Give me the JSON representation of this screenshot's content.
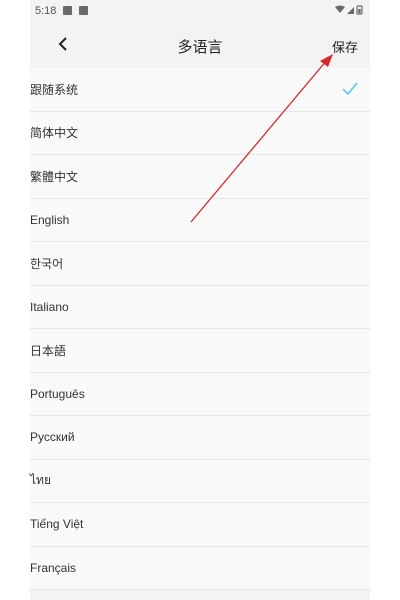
{
  "status_bar": {
    "time": "5:18"
  },
  "header": {
    "title": "多语言",
    "save_label": "保存"
  },
  "languages": [
    {
      "label": "跟随系统",
      "selected": true
    },
    {
      "label": "简体中文",
      "selected": false
    },
    {
      "label": "繁體中文",
      "selected": false
    },
    {
      "label": "English",
      "selected": false
    },
    {
      "label": "한국어",
      "selected": false
    },
    {
      "label": "Italiano",
      "selected": false
    },
    {
      "label": "日本語",
      "selected": false
    },
    {
      "label": "Português",
      "selected": false
    },
    {
      "label": "Русский",
      "selected": false
    },
    {
      "label": "ไทย",
      "selected": false
    },
    {
      "label": "Tiếng Việt",
      "selected": false
    },
    {
      "label": "Français",
      "selected": false
    }
  ],
  "colors": {
    "check": "#4fc3f7",
    "arrow": "#d62828"
  }
}
